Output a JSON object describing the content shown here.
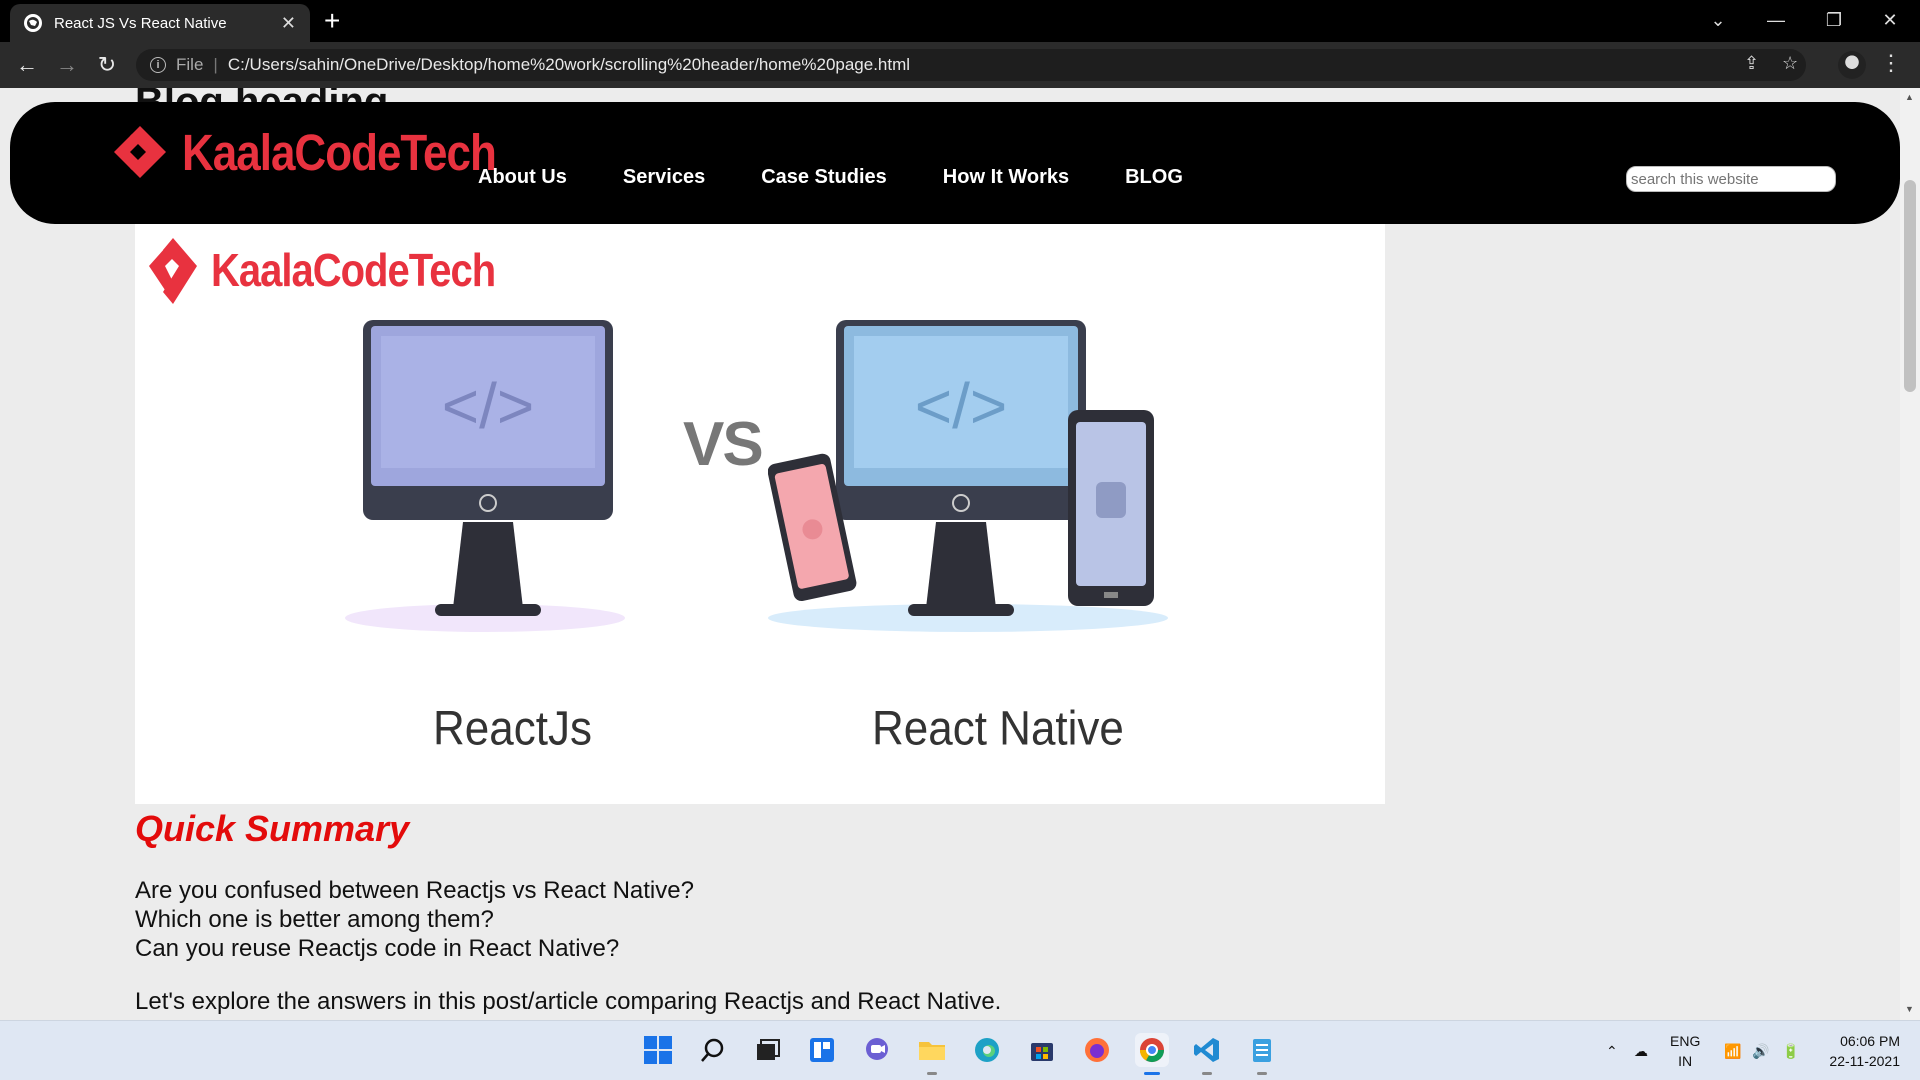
{
  "browser": {
    "tab_title": "React JS Vs React Native",
    "file_label": "File",
    "url": "C:/Users/sahin/OneDrive/Desktop/home%20work/scrolling%20header/home%20page.html"
  },
  "page": {
    "behind_heading": "Blog heading",
    "header": {
      "logo_text": "KaalaCodeTech",
      "nav": [
        "About Us",
        "Services",
        "Case Studies",
        "How It Works",
        "BLOG"
      ],
      "search_placeholder": "search this website"
    },
    "hero": {
      "logo_text": "KaalaCodeTech",
      "vs_text": "VS",
      "left_label": "ReactJs",
      "right_label": "React Native"
    },
    "article": {
      "summary_title": "Quick Summary",
      "lines": [
        "Are you confused between Reactjs vs React Native?",
        "Which one is better among them?",
        "Can you reuse Reactjs code in React Native?"
      ],
      "line4": "Let's explore the answers in this post/article comparing Reactjs and React Native."
    }
  },
  "taskbar": {
    "lang_top": "ENG",
    "lang_bottom": "IN",
    "time": "06:06 PM",
    "date": "22-11-2021"
  },
  "colors": {
    "brand_red": "#e8323f",
    "summary_red": "#e30b0b",
    "header_bg": "#000000"
  }
}
